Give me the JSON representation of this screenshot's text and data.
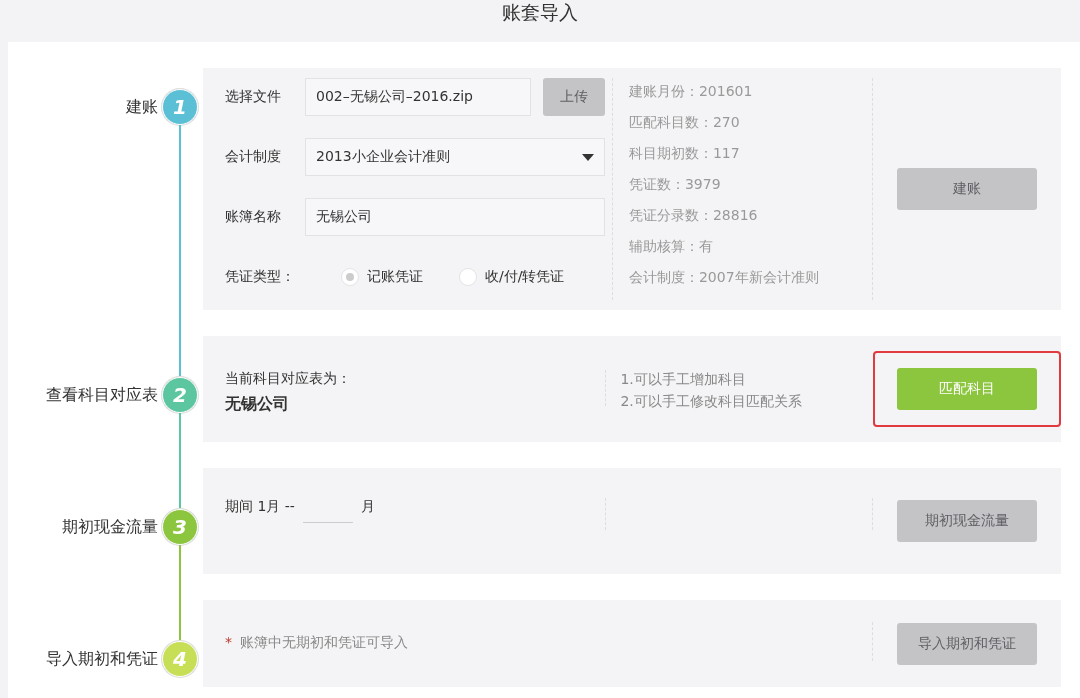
{
  "title": "账套导入",
  "steps": [
    {
      "kind": "setup",
      "number": "1",
      "label": "建账",
      "color": "#5bbfd6",
      "file": {
        "label": "选择文件",
        "value": "002–无锡公司–2016.zip",
        "button": {
          "label": "上传",
          "disabled": true
        }
      },
      "system": {
        "label": "会计制度",
        "value": "2013小企业会计准则"
      },
      "book": {
        "label": "账簿名称",
        "value": "无锡公司"
      },
      "voucher": {
        "label": "凭证类型：",
        "options": [
          {
            "label": "记账凭证",
            "selected": true
          },
          {
            "label": "收/付/转凭证",
            "selected": false
          }
        ]
      },
      "stats": [
        "建账月份：201601",
        "匹配科目数：270",
        "科目期初数：117",
        "凭证数：3979",
        "凭证分录数：28816",
        "辅助核算：有",
        "会计制度：2007年新会计准则"
      ],
      "button": {
        "label": "建账",
        "disabled": true,
        "highlighted": false
      }
    },
    {
      "kind": "mapping",
      "number": "2",
      "label": "查看科目对应表",
      "color": "#5cc6a0",
      "caption": "当前科目对应表为：",
      "value": "无锡公司",
      "notes": [
        "1.可以手工增加科目",
        "2.可以手工修改科目匹配关系"
      ],
      "button": {
        "label": "匹配科目",
        "disabled": false,
        "highlighted": true
      }
    },
    {
      "kind": "period",
      "number": "3",
      "label": "期初现金流量",
      "color": "#8cc63f",
      "prefix": "期间 1月 --",
      "suffix": "月",
      "button": {
        "label": "期初现金流量",
        "disabled": true,
        "highlighted": false
      }
    },
    {
      "kind": "notice",
      "number": "4",
      "label": "导入期初和凭证",
      "color": "#c6df57",
      "mark": "*",
      "text": "账簿中无期初和凭证可导入",
      "button": {
        "label": "导入期初和凭证",
        "disabled": true,
        "highlighted": false
      }
    }
  ]
}
